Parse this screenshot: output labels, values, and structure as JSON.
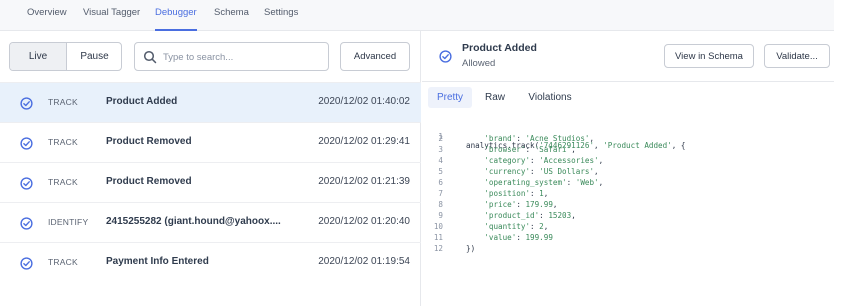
{
  "nav": {
    "tabs": [
      {
        "label": "Overview"
      },
      {
        "label": "Visual Tagger"
      },
      {
        "label": "Debugger"
      },
      {
        "label": "Schema"
      },
      {
        "label": "Settings"
      }
    ],
    "active": "Debugger"
  },
  "toolbar": {
    "live_label": "Live",
    "pause_label": "Pause",
    "search_placeholder": "Type to search...",
    "advanced_label": "Advanced"
  },
  "events": [
    {
      "type": "TRACK",
      "name": "Product Added",
      "time": "2020/12/02 01:40:02",
      "selected": true
    },
    {
      "type": "TRACK",
      "name": "Product Removed",
      "time": "2020/12/02 01:29:41",
      "selected": false
    },
    {
      "type": "TRACK",
      "name": "Product Removed",
      "time": "2020/12/02 01:21:39",
      "selected": false
    },
    {
      "type": "IDENTIFY",
      "name": "2415255282 (giant.hound@yahoox....",
      "time": "2020/12/02 01:20:40",
      "selected": false
    },
    {
      "type": "TRACK",
      "name": "Payment Info Entered",
      "time": "2020/12/02 01:19:54",
      "selected": false
    }
  ],
  "detail": {
    "title": "Product Added",
    "status": "Allowed",
    "view_schema_label": "View in Schema",
    "validate_label": "Validate...",
    "tabs": [
      {
        "label": "Pretty"
      },
      {
        "label": "Raw"
      },
      {
        "label": "Violations"
      }
    ],
    "active_tab": "Pretty",
    "code": {
      "open_prefix": "analytics.track(",
      "user_id": "'7446291126'",
      "event_name": "'Product Added'",
      "open_suffix": ", {",
      "properties": [
        {
          "key": "'brand'",
          "value": "'Acne Studios'",
          "kind": "str"
        },
        {
          "key": "'browser'",
          "value": "'Safari'",
          "kind": "str"
        },
        {
          "key": "'category'",
          "value": "'Accessories'",
          "kind": "str"
        },
        {
          "key": "'currency'",
          "value": "'US Dollars'",
          "kind": "str"
        },
        {
          "key": "'operating_system'",
          "value": "'Web'",
          "kind": "str"
        },
        {
          "key": "'position'",
          "value": "1",
          "kind": "num"
        },
        {
          "key": "'price'",
          "value": "179.99",
          "kind": "num"
        },
        {
          "key": "'product_id'",
          "value": "15203",
          "kind": "num"
        },
        {
          "key": "'quantity'",
          "value": "2",
          "kind": "num"
        },
        {
          "key": "'value'",
          "value": "199.99",
          "kind": "num"
        }
      ],
      "close": "})"
    }
  },
  "colors": {
    "accent": "#4a6ee0",
    "selected_row": "#e8f1fb",
    "check_icon": "#4a6ee0",
    "code_string": "#3a8a5a"
  }
}
